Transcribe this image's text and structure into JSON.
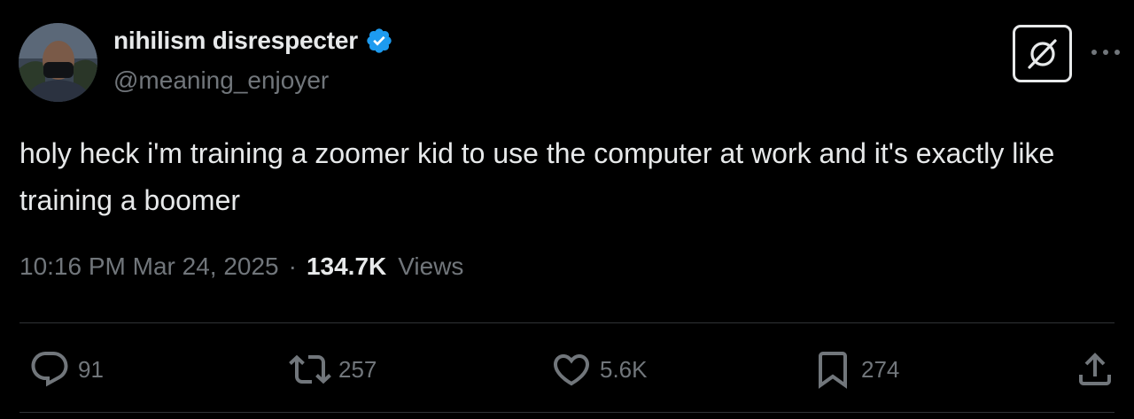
{
  "author": {
    "display_name": "nihilism disrespecter",
    "handle": "@meaning_enjoyer",
    "verified": true
  },
  "tweet": {
    "text": "holy heck i'm training a zoomer kid to use the computer at work and it's exactly like training a boomer",
    "timestamp": "10:16 PM Mar 24, 2025",
    "separator": "·",
    "views_count": "134.7K",
    "views_label": "Views"
  },
  "actions": {
    "replies": "91",
    "reposts": "257",
    "likes": "5.6K",
    "bookmarks": "274"
  },
  "icons": {
    "grok": "grok-icon",
    "more": "more-icon",
    "reply": "reply-icon",
    "repost": "repost-icon",
    "like": "heart-icon",
    "bookmark": "bookmark-icon",
    "share": "share-icon",
    "verified": "verified-badge-icon"
  },
  "colors": {
    "background": "#000000",
    "text_primary": "#e7e9ea",
    "text_secondary": "#71767b",
    "verified_blue": "#1d9bf0",
    "divider": "#2f3336"
  }
}
